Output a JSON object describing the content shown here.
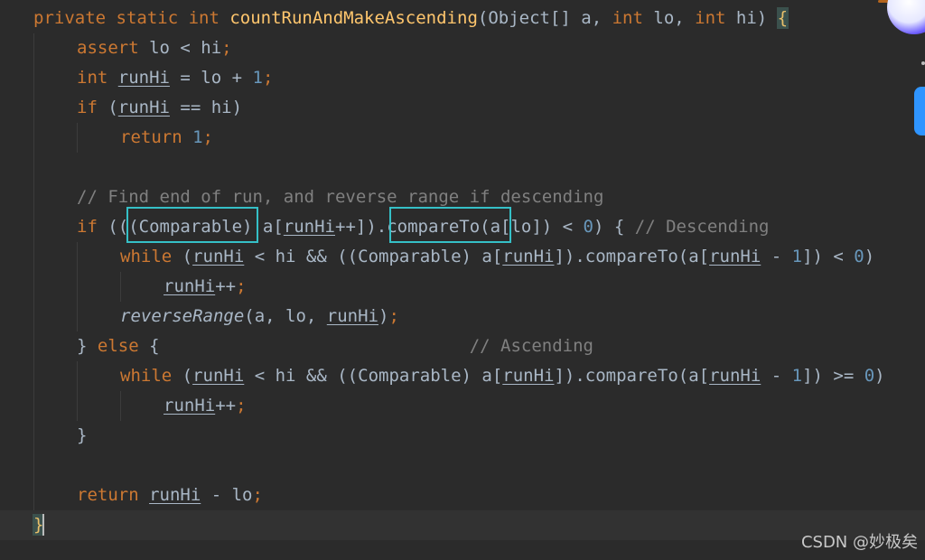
{
  "code": {
    "lines": [
      {
        "tokens": [
          {
            "t": "private static int ",
            "c": "kw"
          },
          {
            "t": "countRunAndMakeAscending",
            "c": "fn"
          },
          {
            "t": "(Object[] a, ",
            "c": ""
          },
          {
            "t": "int ",
            "c": "kw"
          },
          {
            "t": "lo, ",
            "c": ""
          },
          {
            "t": "int ",
            "c": "kw"
          },
          {
            "t": "hi) ",
            "c": ""
          },
          {
            "t": "{",
            "c": "brace yel"
          }
        ]
      },
      {
        "tokens": [
          {
            "t": "assert ",
            "c": "kw"
          },
          {
            "t": "lo < hi",
            "c": ""
          },
          {
            "t": ";",
            "c": "kw"
          }
        ]
      },
      {
        "tokens": [
          {
            "t": "int ",
            "c": "kw"
          },
          {
            "t": "runHi",
            "c": "var"
          },
          {
            "t": " = lo + ",
            "c": ""
          },
          {
            "t": "1",
            "c": "num"
          },
          {
            "t": ";",
            "c": "kw"
          }
        ]
      },
      {
        "tokens": [
          {
            "t": "if ",
            "c": "kw"
          },
          {
            "t": "(",
            "c": ""
          },
          {
            "t": "runHi",
            "c": "var"
          },
          {
            "t": " == hi)",
            "c": ""
          }
        ]
      },
      {
        "tokens": [
          {
            "t": "return ",
            "c": "kw"
          },
          {
            "t": "1",
            "c": "num"
          },
          {
            "t": ";",
            "c": "kw"
          }
        ]
      },
      {
        "tokens": []
      },
      {
        "tokens": [
          {
            "t": "// Find end of run, and reverse range if descending",
            "c": "cm"
          }
        ]
      },
      {
        "tokens": [
          {
            "t": "if ",
            "c": "kw"
          },
          {
            "t": "(((Comparable) a[",
            "c": ""
          },
          {
            "t": "runHi",
            "c": "var"
          },
          {
            "t": "++]).compareTo(a[lo]) < ",
            "c": ""
          },
          {
            "t": "0",
            "c": "num"
          },
          {
            "t": ") { ",
            "c": ""
          },
          {
            "t": "// Descending",
            "c": "cm"
          }
        ]
      },
      {
        "tokens": [
          {
            "t": "while ",
            "c": "kw"
          },
          {
            "t": "(",
            "c": ""
          },
          {
            "t": "runHi",
            "c": "var"
          },
          {
            "t": " < hi && ((Comparable) a[",
            "c": ""
          },
          {
            "t": "runHi",
            "c": "var"
          },
          {
            "t": "]).compareTo(a[",
            "c": ""
          },
          {
            "t": "runHi",
            "c": "var"
          },
          {
            "t": " - ",
            "c": ""
          },
          {
            "t": "1",
            "c": "num"
          },
          {
            "t": "]) < ",
            "c": ""
          },
          {
            "t": "0",
            "c": "num"
          },
          {
            "t": ")",
            "c": ""
          }
        ]
      },
      {
        "tokens": [
          {
            "t": "runHi",
            "c": "var"
          },
          {
            "t": "++",
            "c": ""
          },
          {
            "t": ";",
            "c": "kw"
          }
        ]
      },
      {
        "tokens": [
          {
            "t": "reverseRange",
            "c": "it"
          },
          {
            "t": "(a, lo, ",
            "c": ""
          },
          {
            "t": "runHi",
            "c": "var"
          },
          {
            "t": ")",
            "c": ""
          },
          {
            "t": ";",
            "c": "kw"
          }
        ]
      },
      {
        "tokens": [
          {
            "t": "} ",
            "c": ""
          },
          {
            "t": "else ",
            "c": "kw"
          },
          {
            "t": "{                              ",
            "c": ""
          },
          {
            "t": "// Ascending",
            "c": "cm"
          }
        ]
      },
      {
        "tokens": [
          {
            "t": "while ",
            "c": "kw"
          },
          {
            "t": "(",
            "c": ""
          },
          {
            "t": "runHi",
            "c": "var"
          },
          {
            "t": " < hi && ((Comparable) a[",
            "c": ""
          },
          {
            "t": "runHi",
            "c": "var"
          },
          {
            "t": "]).compareTo(a[",
            "c": ""
          },
          {
            "t": "runHi",
            "c": "var"
          },
          {
            "t": " - ",
            "c": ""
          },
          {
            "t": "1",
            "c": "num"
          },
          {
            "t": "]) >= ",
            "c": ""
          },
          {
            "t": "0",
            "c": "num"
          },
          {
            "t": ")",
            "c": ""
          }
        ]
      },
      {
        "tokens": [
          {
            "t": "runHi",
            "c": "var"
          },
          {
            "t": "++",
            "c": ""
          },
          {
            "t": ";",
            "c": "kw"
          }
        ]
      },
      {
        "tokens": [
          {
            "t": "}",
            "c": ""
          }
        ]
      },
      {
        "tokens": []
      },
      {
        "tokens": [
          {
            "t": "return ",
            "c": "kw"
          },
          {
            "t": "runHi",
            "c": "var"
          },
          {
            "t": " - lo",
            "c": ""
          },
          {
            "t": ";",
            "c": "kw"
          }
        ]
      },
      {
        "tokens": [
          {
            "t": "}",
            "c": "brace yel"
          }
        ]
      }
    ]
  },
  "watermark": "CSDN @妙极矣",
  "colors": {
    "background": "#2b2b2b",
    "keyword": "#cc7832",
    "function": "#ffc66d",
    "number": "#6897bb",
    "comment": "#808080",
    "text": "#a9b7c6",
    "highlight_box": "#35c0c7"
  }
}
